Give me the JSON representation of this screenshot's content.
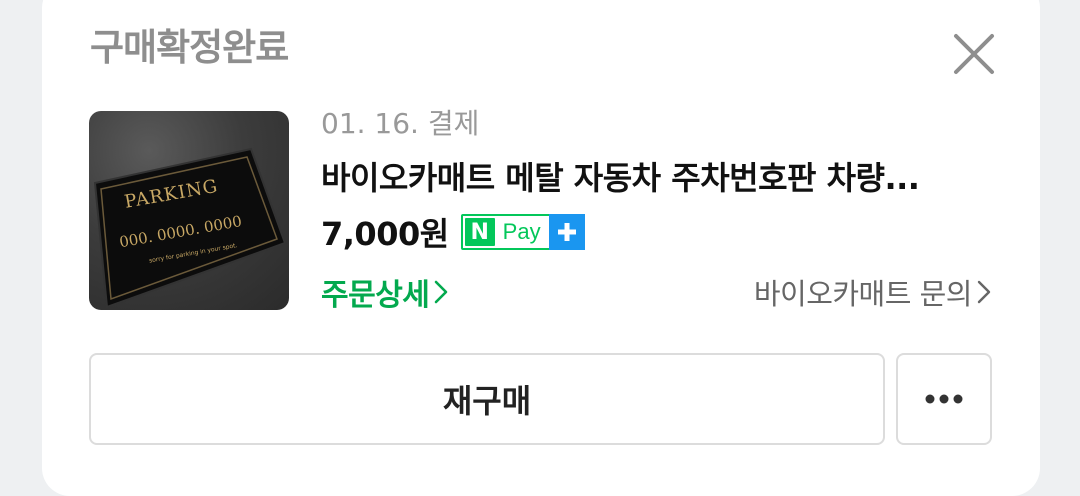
{
  "order": {
    "status_title": "구매확정완료",
    "date_label": "01. 16. 결제",
    "product_name": "바이오카매트 메탈 자동차 주차번호판 차량...",
    "price": "7,000원",
    "order_detail_label": "주문상세",
    "seller_inquiry_label": "바이오카매트 문의",
    "rebuy_label": "재구매"
  },
  "npay_badge": {
    "n": "N",
    "text": "Pay"
  },
  "thumbnail": {
    "title": "PARKING",
    "number": "000. 0000. 0000",
    "caption": "sorry for parking in your spot."
  },
  "icons": {
    "close": "close-icon",
    "chevron": "chevron-right-icon",
    "more": "more-horizontal-icon",
    "plus": "plus-icon"
  },
  "colors": {
    "accent_green": "#03c75a",
    "link_green": "#03a94e",
    "npay_blue": "#1a96f0"
  }
}
